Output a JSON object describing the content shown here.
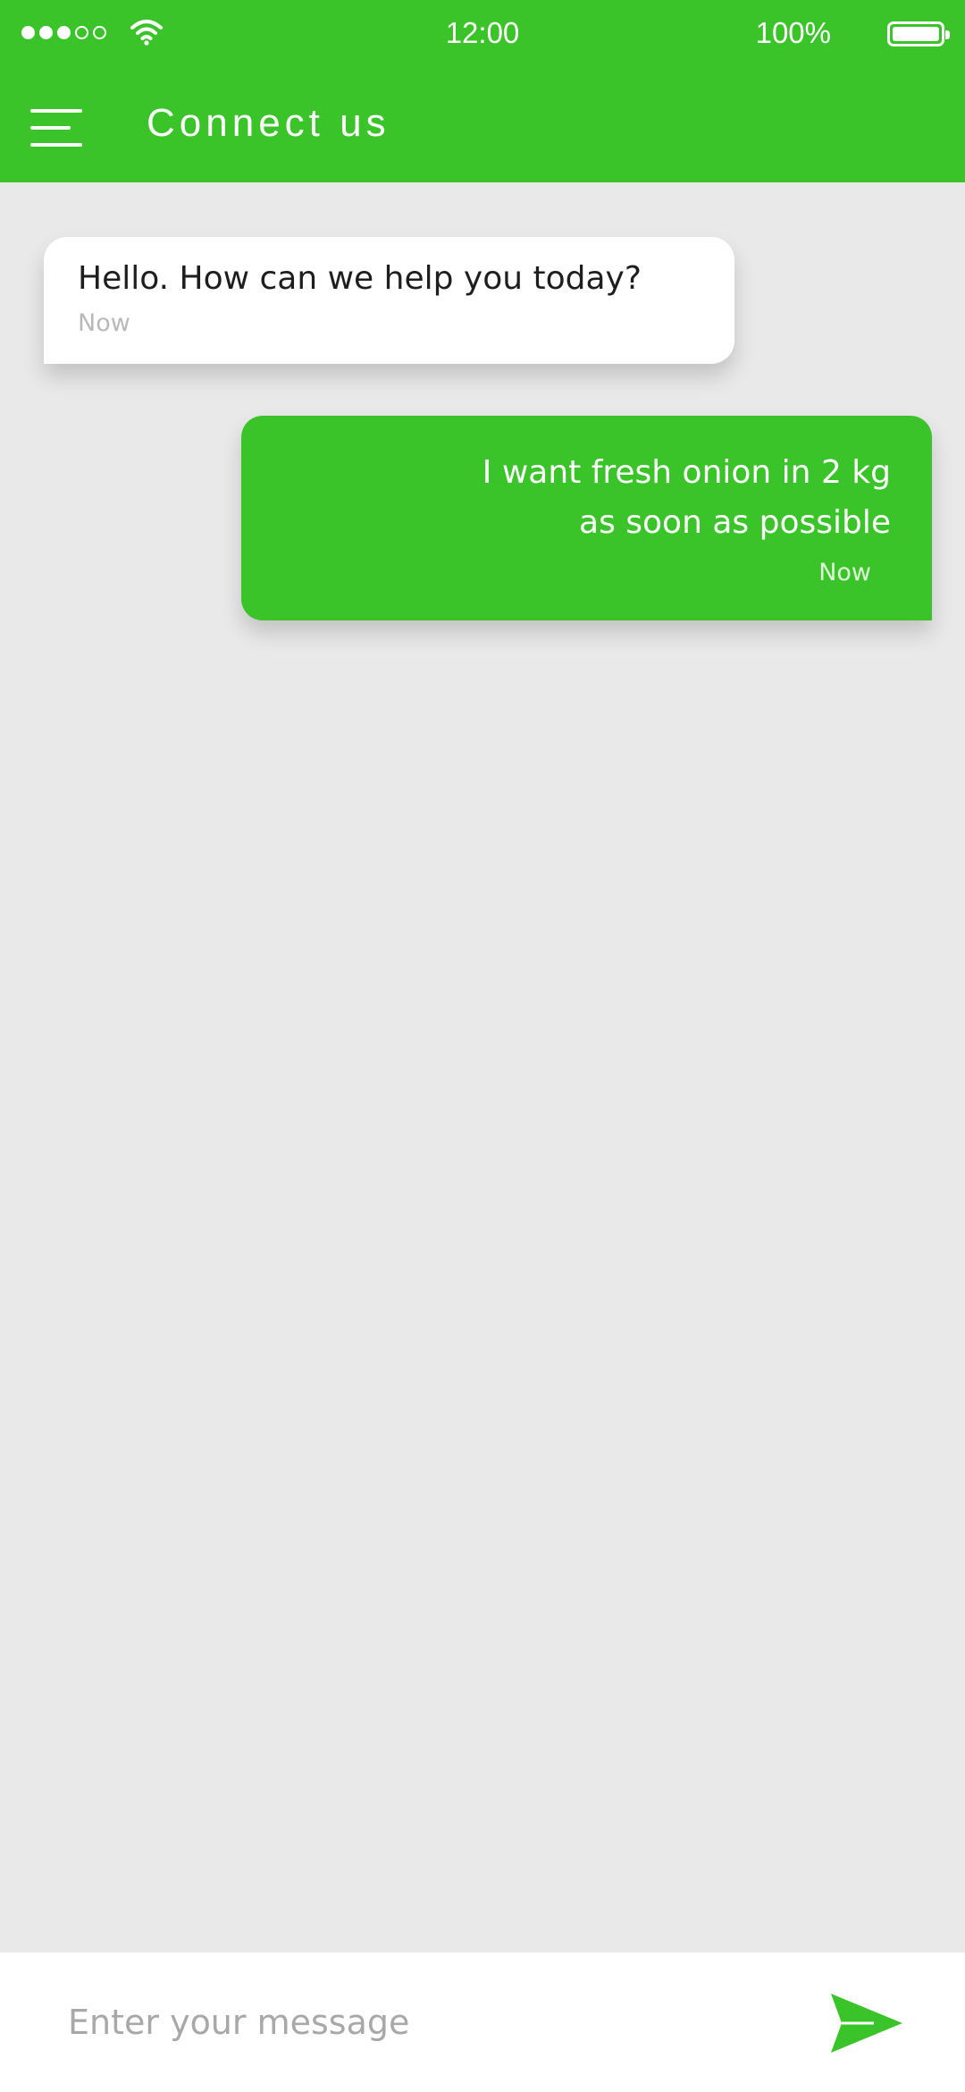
{
  "status_bar": {
    "time": "12:00",
    "battery": "100%",
    "signal_bars_filled": 3,
    "signal_bars_total": 5
  },
  "header": {
    "title": "Connect us",
    "menu_icon": "hamburger-menu-icon"
  },
  "messages": [
    {
      "direction": "incoming",
      "text": "Hello. How can we help you today?",
      "time": "Now"
    },
    {
      "direction": "outgoing",
      "lines": [
        "I want fresh onion in 2 kg",
        "as soon as possible"
      ],
      "time": "Now"
    }
  ],
  "composer": {
    "placeholder": "Enter your message",
    "value": "",
    "send_icon": "send-icon"
  },
  "colors": {
    "accent": "#3bc42a",
    "background": "#e9e9e9",
    "incoming_bubble": "#ffffff"
  }
}
